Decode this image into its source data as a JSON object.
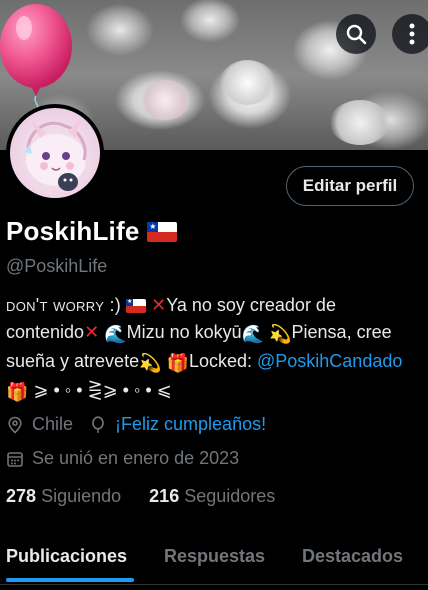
{
  "header": {
    "search_icon": "search-icon",
    "more_icon": "more-vertical-icon"
  },
  "profile": {
    "edit_button": "Editar perfil",
    "display_name": "PoskihLife",
    "handle": "@PoskihLife",
    "bio": {
      "line1_smallcaps": "don't worry :)",
      "line1_rest": "Ya no soy creador de",
      "line2_a": "contenido",
      "line2_b": "Mizu no kokyū",
      "line2_c": "Piensa, cree",
      "line3_a": "sueña y atrevete",
      "line3_b": "Locked: ",
      "line3_mention": "@PoskihCandado",
      "line4": " ⩾ • ◦ • ⋛⩾ • ◦ • ⩽"
    },
    "location": "Chile",
    "birthday": "¡Feliz cumpleaños!",
    "joined": "Se unió en enero de 2023",
    "following_count": "278",
    "following_label": "Siguiendo",
    "followers_count": "216",
    "followers_label": "Seguidores"
  },
  "tabs": [
    {
      "label": "Publicaciones",
      "active": true
    },
    {
      "label": "Respuestas",
      "active": false
    },
    {
      "label": "Destacados",
      "active": false
    }
  ],
  "colors": {
    "accent": "#1d9bf0",
    "background": "#000000",
    "text": "#e7e9ea",
    "muted": "#71767b",
    "border": "#536471"
  }
}
